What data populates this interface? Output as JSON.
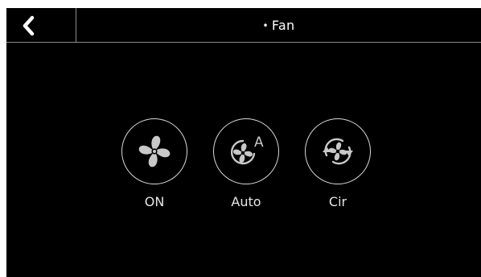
{
  "header": {
    "title": "Fan",
    "bullet": "•",
    "back_icon": "chevron-left-icon"
  },
  "modes": [
    {
      "label": "ON",
      "icon": "fan-icon"
    },
    {
      "label": "Auto",
      "icon": "fan-auto-icon"
    },
    {
      "label": "Cir",
      "icon": "fan-circulation-icon"
    }
  ],
  "colors": {
    "background": "#000000",
    "text": "#ffffff",
    "icon": "#c8c8c8",
    "ring": "#d8d8d8",
    "divider": "#8a8a8a"
  }
}
